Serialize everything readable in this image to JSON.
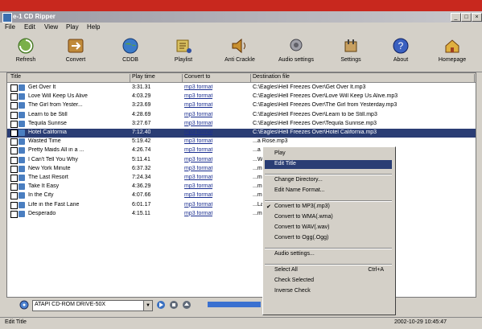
{
  "window": {
    "title": "e-1 CD Ripper",
    "controls": [
      "_",
      "□",
      "×"
    ]
  },
  "menu": [
    "File",
    "Edit",
    "View",
    "Play",
    "Help"
  ],
  "toolbar": [
    {
      "label": "Refresh",
      "icon": "refresh-icon"
    },
    {
      "label": "Convert",
      "icon": "convert-icon"
    },
    {
      "label": "CDDB",
      "icon": "globe-icon"
    },
    {
      "label": "Playlist",
      "icon": "playlist-icon"
    },
    {
      "label": "Anti Crackle",
      "icon": "speaker-icon"
    },
    {
      "label": "Audio settings",
      "icon": "audio-settings-icon"
    },
    {
      "label": "Settings",
      "icon": "settings-icon"
    },
    {
      "label": "About",
      "icon": "help-icon"
    },
    {
      "label": "Homepage",
      "icon": "homepage-icon"
    }
  ],
  "columns": [
    "Title",
    "Play time",
    "Convert to",
    "Destination file"
  ],
  "tracks": [
    {
      "title": "Get Over It",
      "time": "3:31.31",
      "format": "mp3 format",
      "dest": "C:\\Eagles\\Hell Freezes Over\\Get Over It.mp3"
    },
    {
      "title": "Love Will Keep Us Alive",
      "time": "4:03.29",
      "format": "mp3 format",
      "dest": "C:\\Eagles\\Hell Freezes Over\\Love Will Keep Us Alive.mp3"
    },
    {
      "title": "The Girl from Yester...",
      "time": "3:23.69",
      "format": "mp3 format",
      "dest": "C:\\Eagles\\Hell Freezes Over\\The Girl from Yesterday.mp3"
    },
    {
      "title": "Learn to be Still",
      "time": "4:28.69",
      "format": "mp3 format",
      "dest": "C:\\Eagles\\Hell Freezes Over\\Learn to be Still.mp3"
    },
    {
      "title": "Tequila Sunrise",
      "time": "3:27.67",
      "format": "mp3 format",
      "dest": "C:\\Eagles\\Hell Freezes Over\\Tequila Sunrise.mp3"
    },
    {
      "title": "Hotel California",
      "time": "7:12.40",
      "format": "mp3 format",
      "dest": "C:\\Eagles\\Hell Freezes Over\\Hotel California.mp3"
    },
    {
      "title": "Wasted Time",
      "time": "5:19.42",
      "format": "mp3 format",
      "dest": "...a Rose.mp3"
    },
    {
      "title": "Pretty Maids All in a ...",
      "time": "4:26.74",
      "format": "mp3 format",
      "dest": "...a Rose.mp3"
    },
    {
      "title": "I Can't Tell You Why",
      "time": "5:11.41",
      "format": "mp3 format",
      "dest": "...Why.mp3"
    },
    {
      "title": "New York Minute",
      "time": "6:37.32",
      "format": "mp3 format",
      "dest": "...mp3"
    },
    {
      "title": "The Last Resort",
      "time": "7:24.34",
      "format": "mp3 format",
      "dest": "...mp3"
    },
    {
      "title": "Take It Easy",
      "time": "4:36.29",
      "format": "mp3 format",
      "dest": "...mp3"
    },
    {
      "title": "In the City",
      "time": "4:07.66",
      "format": "mp3 format",
      "dest": "...mp3"
    },
    {
      "title": "Life in the Fast Lane",
      "time": "6:01.17",
      "format": "mp3 format",
      "dest": "...Lane.mp3"
    },
    {
      "title": "Desperado",
      "time": "4:15.11",
      "format": "mp3 format",
      "dest": "...mp3"
    }
  ],
  "selected_index": 5,
  "context_menu": {
    "items": [
      {
        "label": "Play"
      },
      {
        "label": "Edit Title",
        "highlight": true
      },
      {
        "sep": true
      },
      {
        "label": "Change Directory..."
      },
      {
        "label": "Edit Name Format..."
      },
      {
        "sep": true
      },
      {
        "label": "Convert to MP3(.mp3)",
        "checked": true
      },
      {
        "label": "Convert to WMA(.wma)"
      },
      {
        "label": "Convert to WAV(.wav)"
      },
      {
        "label": "Convert to Ogg(.Ogg)"
      },
      {
        "sep": true
      },
      {
        "label": "Audio settings..."
      },
      {
        "sep": true
      },
      {
        "label": "Select All",
        "shortcut": "Ctrl+A"
      },
      {
        "label": "Check Selected"
      },
      {
        "label": "Inverse Check"
      }
    ]
  },
  "drive": "ATAPI CD-ROM DRIVE-50X",
  "status": {
    "left": "Edit Title",
    "right": "2002-10-29 10:45:47"
  },
  "colors": {
    "accent": "#2a3d74",
    "titlebar": "#9a9aa4",
    "red_band": "#c8281e"
  }
}
